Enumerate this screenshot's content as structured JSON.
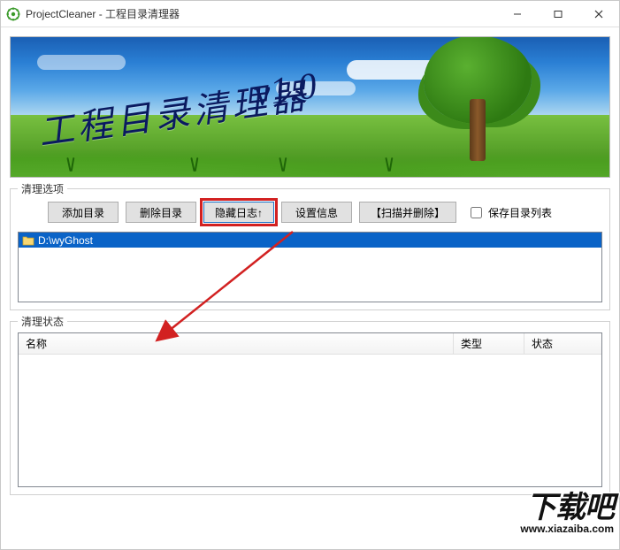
{
  "window": {
    "title": "ProjectCleaner - 工程目录清理器"
  },
  "banner": {
    "title_cn": "工程目录清理器",
    "version": "v1.0"
  },
  "options_group": {
    "label": "清理选项",
    "buttons": {
      "add_dir": "添加目录",
      "del_dir": "删除目录",
      "hide_log": "隐藏日志↑",
      "settings": "设置信息",
      "scan_delete": "【扫描并删除】"
    },
    "save_list_label": "保存目录列表",
    "save_list_checked": false,
    "list_items": [
      {
        "path": "D:\\wyGhost",
        "selected": true
      }
    ]
  },
  "status_group": {
    "label": "清理状态",
    "columns": {
      "name": "名称",
      "type": "类型",
      "status": "状态"
    }
  },
  "watermark": {
    "brand": "下载吧",
    "url": "www.xiazaiba.com"
  }
}
